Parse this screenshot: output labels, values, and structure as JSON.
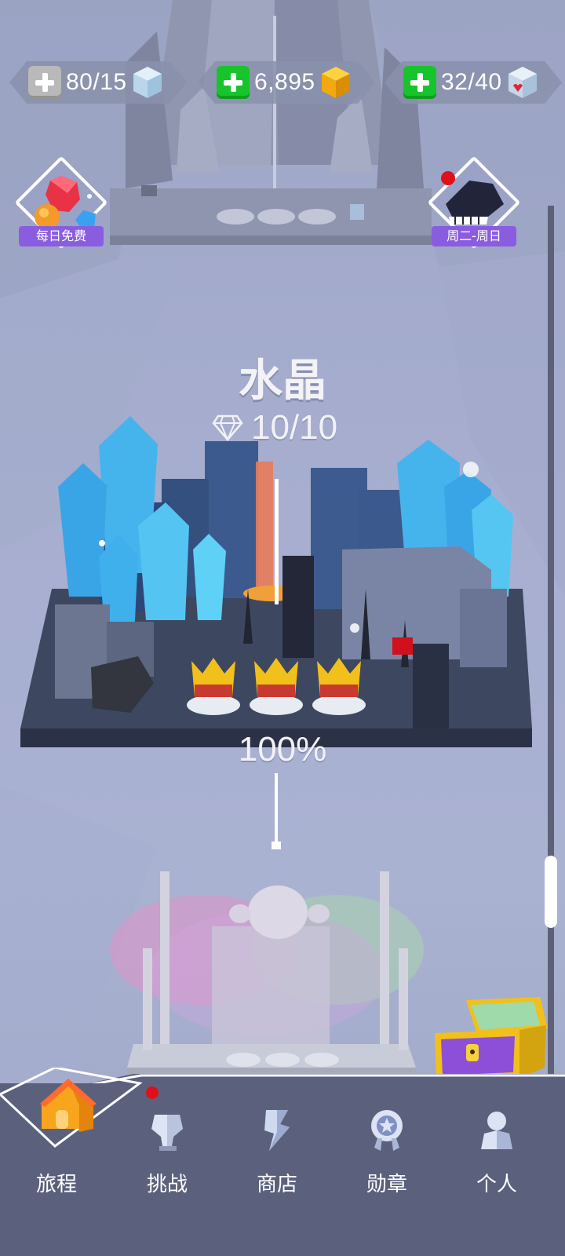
{
  "resources": [
    {
      "value": "80/15",
      "plus_color": "grey",
      "icon": "ice-cube-icon",
      "cube_color": "#cfe4f2"
    },
    {
      "value": "6,895",
      "plus_color": "green",
      "icon": "gold-cube-icon",
      "cube_color": "#f4b417"
    },
    {
      "value": "32/40",
      "plus_color": "green",
      "icon": "heart-cube-icon",
      "cube_color": "#d6e3f0"
    }
  ],
  "side_buttons": {
    "daily_free": {
      "label": "每日免费",
      "icon": "gems-icon"
    },
    "weekday_event": {
      "label": "周二-周日",
      "icon": "piano-icon"
    }
  },
  "level": {
    "title": "水晶",
    "gems": "10/10",
    "percent": "100%"
  },
  "nav": [
    {
      "label": "旅程",
      "icon": "home-icon"
    },
    {
      "label": "挑战",
      "icon": "trophy-icon"
    },
    {
      "label": "商店",
      "icon": "shop-icon"
    },
    {
      "label": "勋章",
      "icon": "medal-icon"
    },
    {
      "label": "个人",
      "icon": "profile-icon"
    }
  ],
  "colors": {
    "background": "#a7aed0",
    "nav": "#5b617c",
    "plus_green": "#17c42c",
    "badge_purple": "#8a5de0",
    "notification": "#e0101a"
  }
}
